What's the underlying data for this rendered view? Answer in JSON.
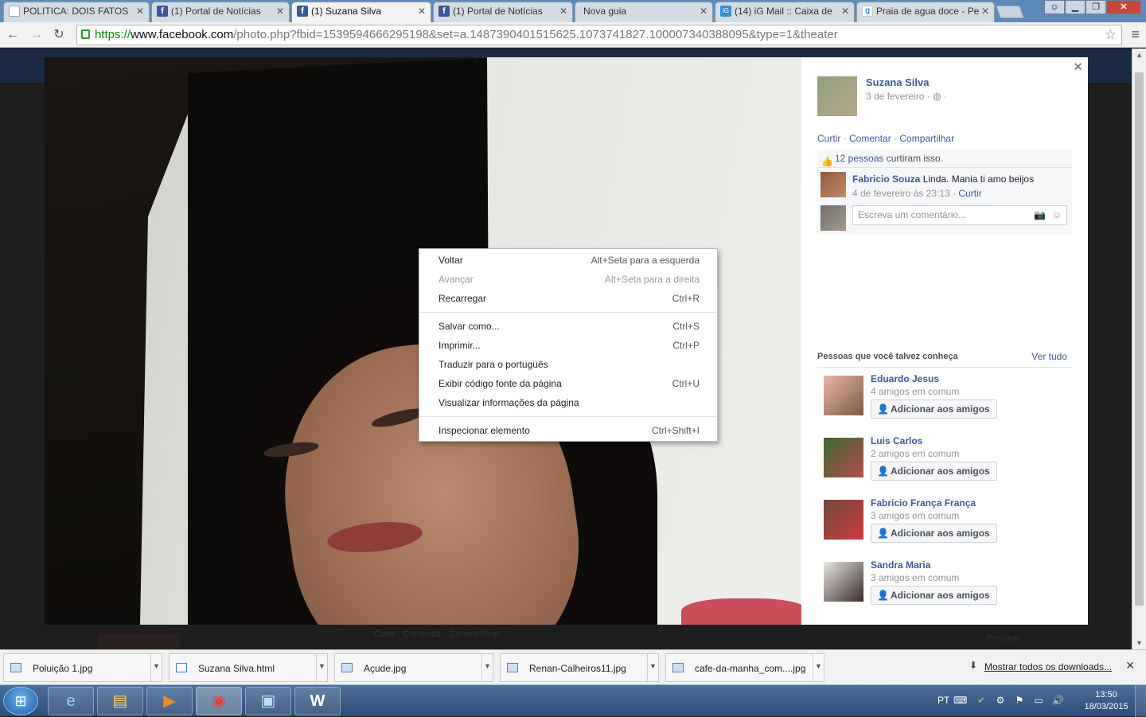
{
  "browser": {
    "tabs": [
      {
        "label": "POLITICA: DOIS FATOS",
        "icon": "document-icon"
      },
      {
        "label": "(1) Portal de Notícias",
        "icon": "facebook-icon"
      },
      {
        "label": "(1) Suzana Silva",
        "icon": "facebook-icon",
        "active": true
      },
      {
        "label": "(1) Portal de Notícias",
        "icon": "facebook-icon"
      },
      {
        "label": "Nova guia",
        "icon": ""
      },
      {
        "label": "(14) iG Mail :: Caixa de",
        "icon": "ig-icon"
      },
      {
        "label": "Praia de agua doce - Pe",
        "icon": "google-icon"
      }
    ],
    "url": {
      "scheme": "https://",
      "host": "www.facebook.com",
      "path": "/photo.php?fbid=1539594666295198&set=a.1487390401515625.1073741827.100007340388095&type=1&theater"
    }
  },
  "post": {
    "author": "Suzana Silva",
    "date": "3 de fevereiro",
    "date_suffix": "· ◍ ·",
    "actions": {
      "like": "Curtir",
      "comment": "Comentar",
      "share": "Compartilhar",
      "sep": " · "
    },
    "likes": {
      "count": "12 pessoas",
      "suffix": " curtiram isso."
    },
    "comment": {
      "name": "Fabricio Souza",
      "text": " Linda. Mania ti amo beijos",
      "time": "4 de fevereiro às 23:13 · ",
      "like": "Curtir"
    },
    "comment_input_placeholder": "Escreva um comentário..."
  },
  "pymk": {
    "title": "Pessoas que você talvez conheça",
    "see_all": "Ver tudo",
    "add_label": "Adicionar aos amigos",
    "people": [
      {
        "name": "Eduardo Jesus",
        "mutual": "4 amigos em comum"
      },
      {
        "name": "Luis Carlos",
        "mutual": "2 amigos em comum"
      },
      {
        "name": "Fabricio França França",
        "mutual": "3 amigos em comum"
      },
      {
        "name": "Sandra Maria",
        "mutual": "3 amigos em comum"
      }
    ]
  },
  "context_menu": [
    {
      "label": "Voltar",
      "shortcut": "Alt+Seta para a esquerda",
      "disabled": false
    },
    {
      "label": "Avançar",
      "shortcut": "Alt+Seta para a direita",
      "disabled": true
    },
    {
      "label": "Recarregar",
      "shortcut": "Ctrl+R",
      "disabled": false
    },
    {
      "label": "Salvar como...",
      "shortcut": "Ctrl+S",
      "disabled": false
    },
    {
      "label": "Imprimir...",
      "shortcut": "Ctrl+P",
      "disabled": false
    },
    {
      "label": "Traduzir para o português",
      "shortcut": "",
      "disabled": false
    },
    {
      "label": "Exibir código fonte da página",
      "shortcut": "Ctrl+U",
      "disabled": false
    },
    {
      "label": "Visualizar informações da página",
      "shortcut": "",
      "disabled": false
    },
    {
      "label": "Inspecionar elemento",
      "shortcut": "Ctrl+Shift+I",
      "disabled": false
    }
  ],
  "background_page": {
    "actions": "Curtir · Comentar · Compartilhar",
    "search": "Procurar"
  },
  "downloads": {
    "items": [
      "Poluição 1.jpg",
      "Suzana Silva.html",
      "Açude.jpg",
      "Renan-Calheiros11.jpg",
      "cafe-da-manha_com....jpg"
    ],
    "show_all": "Mostrar todos os downloads..."
  },
  "taskbar": {
    "apps": [
      "internet-explorer-icon",
      "file-explorer-icon",
      "media-player-icon",
      "chrome-icon",
      "photo-viewer-icon",
      "word-icon"
    ],
    "language": "PT",
    "time": "13:50",
    "date": "18/03/2015"
  },
  "colors": {
    "facebook_blue": "#3b5998",
    "link": "#3b5998",
    "muted": "#90949c",
    "close_red": "#c74635"
  }
}
